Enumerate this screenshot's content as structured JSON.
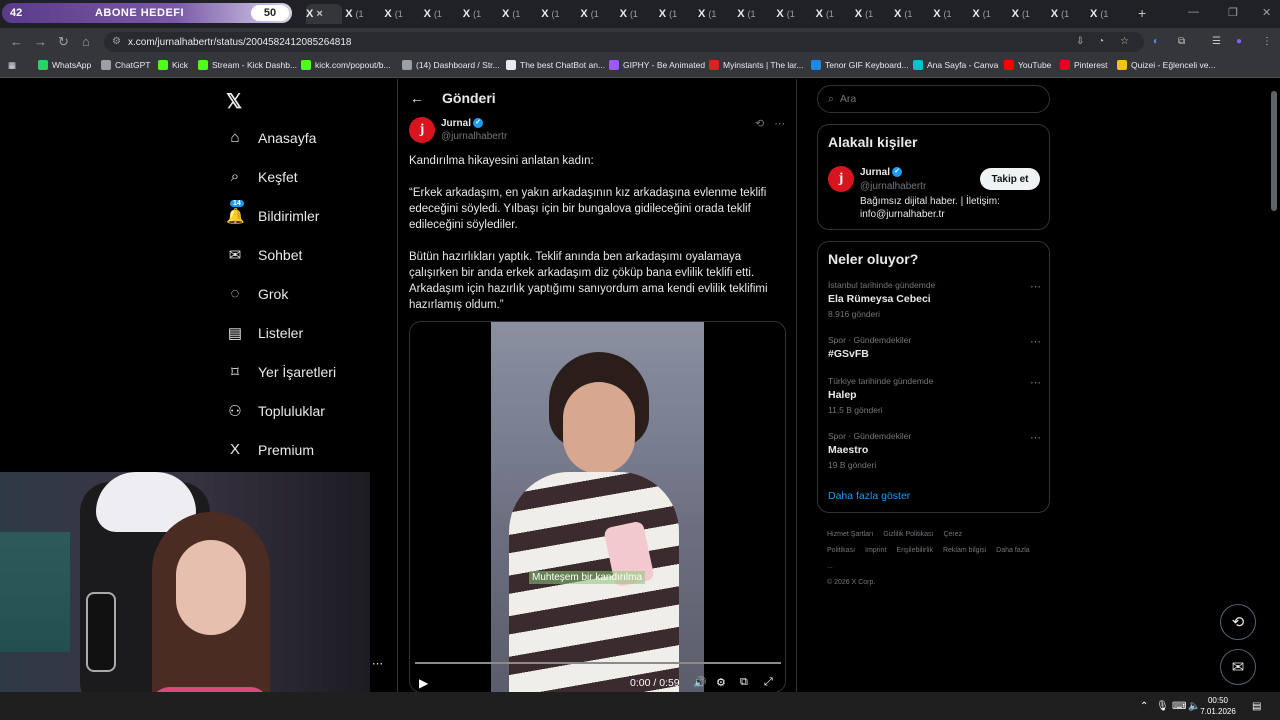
{
  "stream_overlay": {
    "left_value": "42",
    "title": "ABONE HEDEFI",
    "goal_value": "50"
  },
  "browser": {
    "active_tab_icon": "x-logo",
    "tab_label": "(1",
    "tab_count_visible": 21,
    "url": "x.com/jurnalhabertr/status/2004582412085264818",
    "bookmarks": [
      {
        "label": "WhatsApp",
        "icon": "whatsapp-icon",
        "color": "#25d366"
      },
      {
        "label": "ChatGPT",
        "icon": "chatgpt-icon",
        "color": "#9aa0a6"
      },
      {
        "label": "Kick",
        "icon": "kick-icon",
        "color": "#53fc18"
      },
      {
        "label": "Stream - Kick Dashb...",
        "icon": "kick-icon",
        "color": "#53fc18"
      },
      {
        "label": "kick.com/popout/b...",
        "icon": "kick-icon",
        "color": "#53fc18"
      },
      {
        "label": "(14) Dashboard / Str...",
        "icon": "dashboard-icon",
        "color": "#9aa0a6"
      },
      {
        "label": "The best ChatBot an...",
        "icon": "chatbot-icon",
        "color": "#e8eaed"
      },
      {
        "label": "GIPHY - Be Animated",
        "icon": "giphy-icon",
        "color": "#9b59ff"
      },
      {
        "label": "Myinstants | The lar...",
        "icon": "myinstants-icon",
        "color": "#e02020"
      },
      {
        "label": "Tenor GIF Keyboard...",
        "icon": "tenor-icon",
        "color": "#1e88e5"
      },
      {
        "label": "Ana Sayfa - Canva",
        "icon": "canva-icon",
        "color": "#00c4cc"
      },
      {
        "label": "YouTube",
        "icon": "youtube-icon",
        "color": "#ff0000"
      },
      {
        "label": "Pinterest",
        "icon": "pinterest-icon",
        "color": "#e60023"
      },
      {
        "label": "Quizei - Eğlenceli ve...",
        "icon": "quiz-icon",
        "color": "#f1c40f"
      }
    ]
  },
  "nav": {
    "items": [
      {
        "label": "Anasayfa",
        "icon": "home-icon",
        "glyph": "⌂"
      },
      {
        "label": "Keşfet",
        "icon": "search-icon",
        "glyph": "⌕"
      },
      {
        "label": "Bildirimler",
        "icon": "bell-icon",
        "glyph": "🔔"
      },
      {
        "label": "Sohbet",
        "icon": "mail-icon",
        "glyph": "✉"
      },
      {
        "label": "Grok",
        "icon": "grok-icon",
        "glyph": "◌"
      },
      {
        "label": "Listeler",
        "icon": "list-icon",
        "glyph": "▤"
      },
      {
        "label": "Yer İşaretleri",
        "icon": "bookmark-icon",
        "glyph": "⌑"
      },
      {
        "label": "Topluluklar",
        "icon": "communities-icon",
        "glyph": "⚇"
      },
      {
        "label": "Premium",
        "icon": "x-premium-icon",
        "glyph": "X"
      }
    ],
    "notification_badge": "14"
  },
  "post": {
    "header_title": "Gönderi",
    "author_name": "Jurnal",
    "author_handle": "@jurnalhabertr",
    "avatar_letter": "j",
    "paragraphs": [
      "Kandırılma hikayesini anlatan kadın:",
      "“Erkek arkadaşım, en yakın arkadaşının kız arkadaşına evlenme teklifi edeceğini söyledi. Yılbaşı için bir bungalova gidileceğini orada teklif edileceğini söylediler.",
      "Bütün hazırlıkları yaptık. Teklif anında ben arkadaşımı oyalamaya çalışırken bir anda erkek arkadaşım diz çöküp bana evlilik teklifi etti. Arkadaşım için hazırlık yaptığımı sanıyordum ama kendi evlilik teklifimi hazırlamış oldum.”"
    ],
    "video": {
      "subtitle": "Muhteşem bir kandırılma",
      "time": "0:00 / 0:59"
    }
  },
  "sidebar": {
    "search_placeholder": "Ara",
    "related_title": "Alakalı kişiler",
    "related": {
      "name": "Jurnal",
      "handle": "@jurnalhabertr",
      "follow_label": "Takip et",
      "bio": "Bağımsız dijital haber. | İletişim: info@jurnalhaber.tr"
    },
    "trends_title": "Neler oluyor?",
    "trends": [
      {
        "context": "İstanbul tarihinde gündemde",
        "title": "Ela Rümeysa Cebeci",
        "count": "8.916 gönderi"
      },
      {
        "context": "Spor · Gündemdekiler",
        "title": "#GSvFB",
        "count": ""
      },
      {
        "context": "Türkiye tarihinde gündemde",
        "title": "Halep",
        "count": "11,5 B gönderi"
      },
      {
        "context": "Spor · Gündemdekiler",
        "title": "Maestro",
        "count": "19 B gönderi"
      }
    ],
    "show_more": "Daha fazla göster",
    "footer_links": [
      "Hizmet Şartları",
      "Gizlilik Politikası",
      "Çerez Politikası",
      "Imprint",
      "Erişilebilirlik",
      "Reklam bilgisi",
      "Daha fazla ..."
    ],
    "copyright": "© 2026 X Corp."
  },
  "taskbar": {
    "time": "00:50",
    "date": "7.01.2026"
  }
}
